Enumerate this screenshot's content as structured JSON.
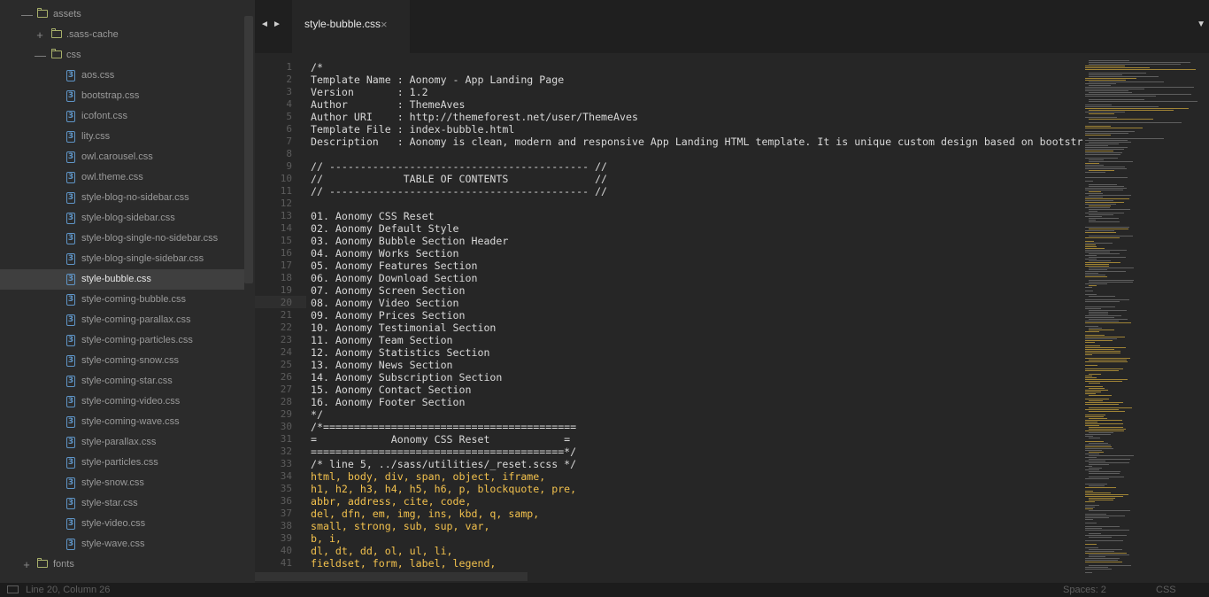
{
  "sidebar": {
    "rows": [
      {
        "label": "assets",
        "type": "folder",
        "open": true,
        "indent": 1
      },
      {
        "label": ".sass-cache",
        "type": "folder",
        "open": false,
        "indent": 2
      },
      {
        "label": "css",
        "type": "folder",
        "open": true,
        "indent": 2
      },
      {
        "label": "aos.css",
        "type": "file",
        "indent": 3
      },
      {
        "label": "bootstrap.css",
        "type": "file",
        "indent": 3
      },
      {
        "label": "icofont.css",
        "type": "file",
        "indent": 3
      },
      {
        "label": "lity.css",
        "type": "file",
        "indent": 3
      },
      {
        "label": "owl.carousel.css",
        "type": "file",
        "indent": 3
      },
      {
        "label": "owl.theme.css",
        "type": "file",
        "indent": 3
      },
      {
        "label": "style-blog-no-sidebar.css",
        "type": "file",
        "indent": 3
      },
      {
        "label": "style-blog-sidebar.css",
        "type": "file",
        "indent": 3
      },
      {
        "label": "style-blog-single-no-sidebar.css",
        "type": "file",
        "indent": 3
      },
      {
        "label": "style-blog-single-sidebar.css",
        "type": "file",
        "indent": 3
      },
      {
        "label": "style-bubble.css",
        "type": "file",
        "indent": 3,
        "selected": true
      },
      {
        "label": "style-coming-bubble.css",
        "type": "file",
        "indent": 3
      },
      {
        "label": "style-coming-parallax.css",
        "type": "file",
        "indent": 3
      },
      {
        "label": "style-coming-particles.css",
        "type": "file",
        "indent": 3
      },
      {
        "label": "style-coming-snow.css",
        "type": "file",
        "indent": 3
      },
      {
        "label": "style-coming-star.css",
        "type": "file",
        "indent": 3
      },
      {
        "label": "style-coming-video.css",
        "type": "file",
        "indent": 3
      },
      {
        "label": "style-coming-wave.css",
        "type": "file",
        "indent": 3
      },
      {
        "label": "style-parallax.css",
        "type": "file",
        "indent": 3
      },
      {
        "label": "style-particles.css",
        "type": "file",
        "indent": 3
      },
      {
        "label": "style-snow.css",
        "type": "file",
        "indent": 3
      },
      {
        "label": "style-star.css",
        "type": "file",
        "indent": 3
      },
      {
        "label": "style-video.css",
        "type": "file",
        "indent": 3
      },
      {
        "label": "style-wave.css",
        "type": "file",
        "indent": 3
      },
      {
        "label": "fonts",
        "type": "folder",
        "open": false,
        "indent": 1
      }
    ]
  },
  "tabbar": {
    "prev_glyph": "◄",
    "next_glyph": "►",
    "active_tab": "style-bubble.css",
    "close_glyph": "×",
    "dropdown_glyph": "▼"
  },
  "editor": {
    "highlight_line": 20,
    "lines": [
      {
        "text": "/*"
      },
      {
        "text": "Template Name : Aonomy - App Landing Page"
      },
      {
        "text": "Version       : 1.2"
      },
      {
        "text": "Author        : ThemeAves"
      },
      {
        "text": "Author URI    : http://themeforest.net/user/ThemeAves"
      },
      {
        "text": "Template File : index-bubble.html"
      },
      {
        "text": "Description   : Aonomy is clean, modern and responsive App Landing HTML template. It is unique custom design based on bootstr"
      },
      {
        "text": ""
      },
      {
        "text": "// ------------------------------------------ //"
      },
      {
        "text": "//             TABLE OF CONTENTS              //"
      },
      {
        "text": "// ------------------------------------------ //"
      },
      {
        "text": ""
      },
      {
        "text": "01. Aonomy CSS Reset"
      },
      {
        "text": "02. Aonomy Default Style"
      },
      {
        "text": "03. Aonomy Bubble Section Header"
      },
      {
        "text": "04. Aonomy Works Section"
      },
      {
        "text": "05. Aonomy Features Section"
      },
      {
        "text": "06. Aonomy Download Section"
      },
      {
        "text": "07. Aonomy Screen Section"
      },
      {
        "text": "08. Aonomy Video Section"
      },
      {
        "text": "09. Aonomy Prices Section"
      },
      {
        "text": "10. Aonomy Testimonial Section"
      },
      {
        "text": "11. Aonomy Team Section"
      },
      {
        "text": "12. Aonomy Statistics Section"
      },
      {
        "text": "13. Aonomy News Section"
      },
      {
        "text": "14. Aonomy Subscription Section"
      },
      {
        "text": "15. Aonomy Contact Section"
      },
      {
        "text": "16. Aonomy Footer Section"
      },
      {
        "text": "*/"
      },
      {
        "text": "/*========================================="
      },
      {
        "text": "=            Aonomy CSS Reset            ="
      },
      {
        "text": "=========================================*/"
      },
      {
        "text": "/* line 5, ../sass/utilities/_reset.scss */"
      },
      {
        "text": "html, body, div, span, object, iframe,",
        "sel": true
      },
      {
        "text": "h1, h2, h3, h4, h5, h6, p, blockquote, pre,",
        "sel": true
      },
      {
        "text": "abbr, address, cite, code,",
        "sel": true
      },
      {
        "text": "del, dfn, em, img, ins, kbd, q, samp,",
        "sel": true
      },
      {
        "text": "small, strong, sub, sup, var,",
        "sel": true
      },
      {
        "text": "b, i,",
        "sel": true
      },
      {
        "text": "dl, dt, dd, ol, ul, li,",
        "sel": true
      },
      {
        "text": "fieldset, form, label, legend,",
        "sel": true
      }
    ]
  },
  "status": {
    "position": "Line 20, Column 26",
    "indent": "Spaces: 2",
    "syntax": "CSS"
  },
  "colors": {
    "selector": "#f2c14d",
    "folder": "#a8b06a",
    "css_icon": "#5f95c7"
  }
}
